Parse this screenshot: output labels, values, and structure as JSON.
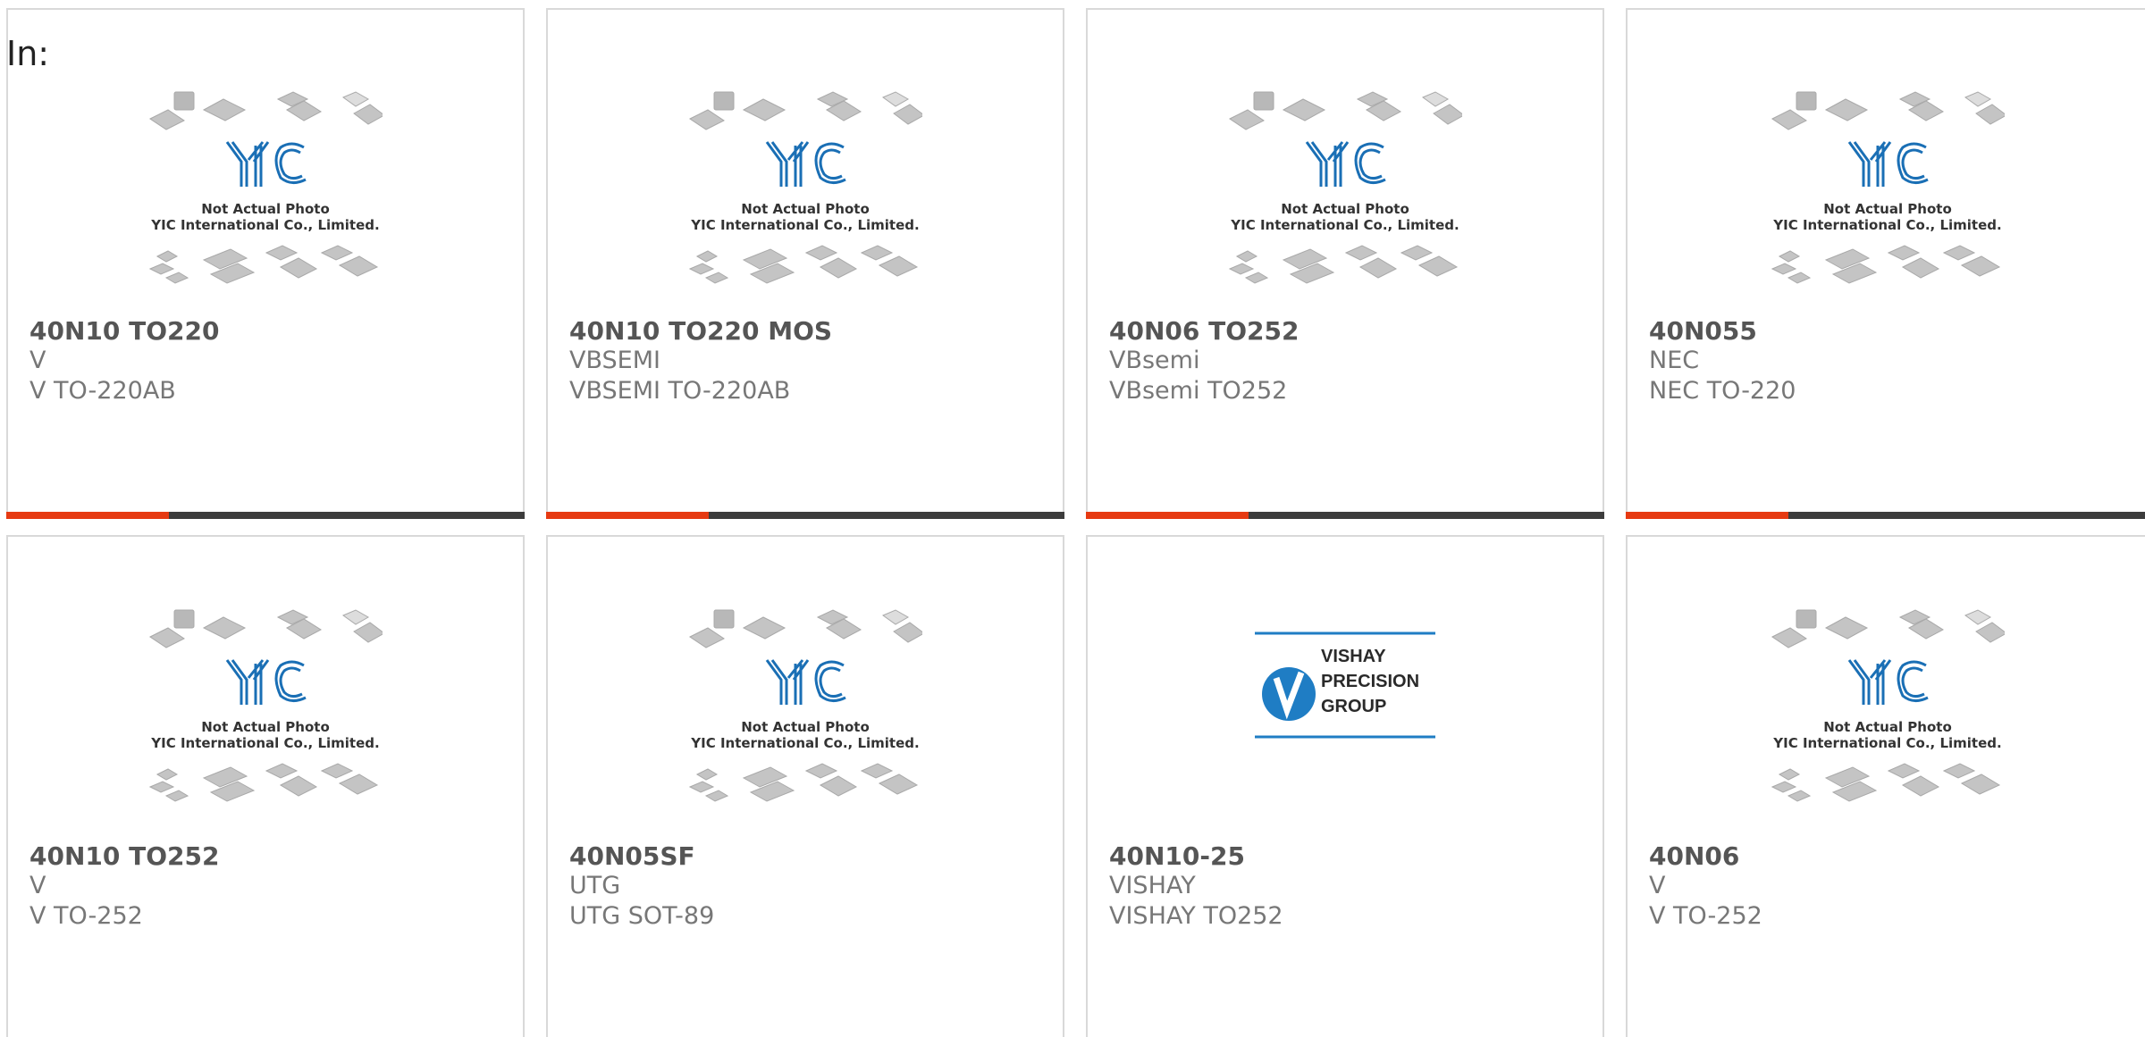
{
  "header": {
    "in_label": "In:"
  },
  "placeholder_image": {
    "caption_line1": "Not Actual Photo",
    "caption_line2": "YIC International Co., Limited.",
    "logo_text": "YIC"
  },
  "vishay_logo": {
    "line1": "VISHAY",
    "line2": "PRECISION",
    "line3": "GROUP"
  },
  "colors": {
    "accent": "#e63a12",
    "bar_dark": "#3c3c3c",
    "yic_blue": "#1a6fb5",
    "vishay_blue": "#1f7dc4"
  },
  "products": [
    {
      "name": "40N10 TO220",
      "brand": "V",
      "package": "V TO-220AB",
      "image": "yic-placeholder"
    },
    {
      "name": "40N10 TO220 MOS",
      "brand": "VBSEMI",
      "package": "VBSEMI TO-220AB",
      "image": "yic-placeholder"
    },
    {
      "name": "40N06 TO252",
      "brand": "VBsemi",
      "package": "VBsemi TO252",
      "image": "yic-placeholder"
    },
    {
      "name": "40N055",
      "brand": "NEC",
      "package": "NEC TO-220",
      "image": "yic-placeholder"
    },
    {
      "name": "40N10 TO252",
      "brand": "V",
      "package": "V TO-252",
      "image": "yic-placeholder"
    },
    {
      "name": "40N05SF",
      "brand": "UTG",
      "package": "UTG SOT-89",
      "image": "yic-placeholder"
    },
    {
      "name": "40N10-25",
      "brand": "VISHAY",
      "package": "VISHAY TO252",
      "image": "vishay-logo"
    },
    {
      "name": "40N06",
      "brand": "V",
      "package": "V TO-252",
      "image": "yic-placeholder"
    }
  ]
}
